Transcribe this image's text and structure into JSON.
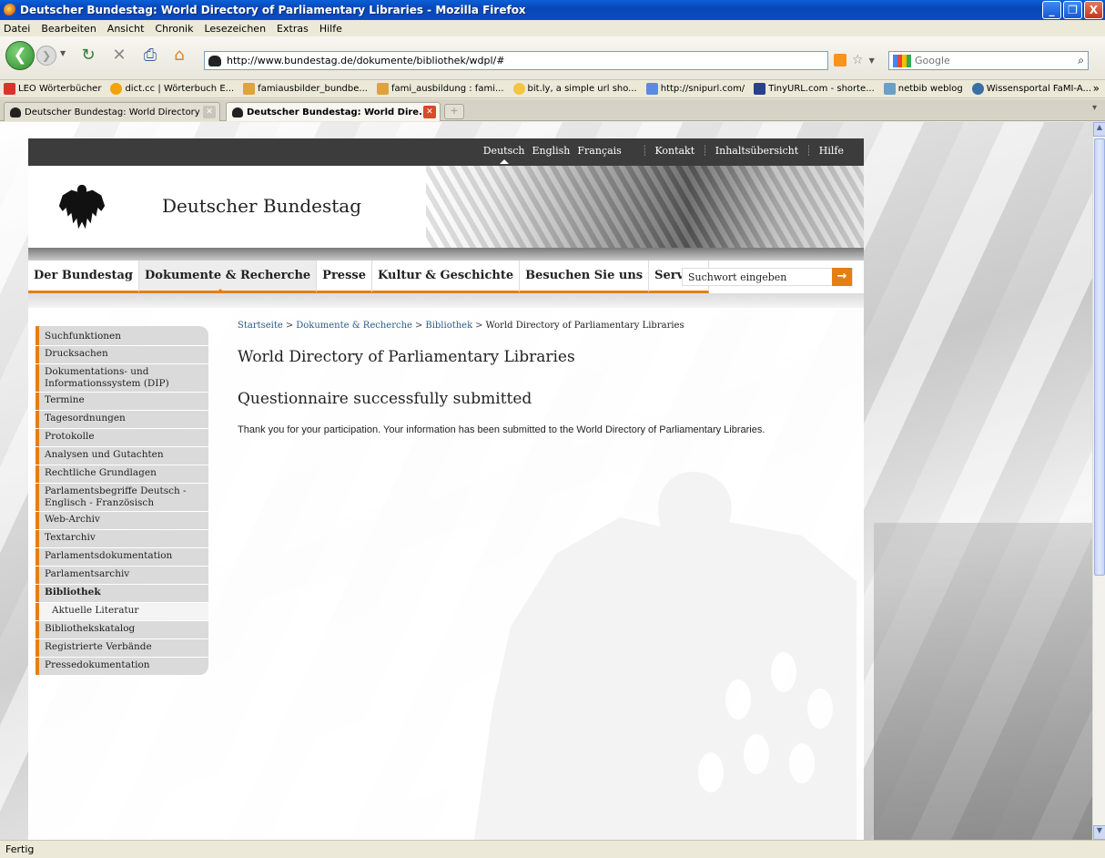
{
  "window": {
    "title": "Deutscher Bundestag: World Directory of Parliamentary Libraries - Mozilla Firefox",
    "buttons": {
      "minimize": "_",
      "maximize": "❐",
      "close": "X"
    }
  },
  "menu": [
    "Datei",
    "Bearbeiten",
    "Ansicht",
    "Chronik",
    "Lesezeichen",
    "Extras",
    "Hilfe"
  ],
  "toolbar": {
    "url": "http://www.bundestag.de/dokumente/bibliothek/wdpl/#",
    "search_placeholder": "Google"
  },
  "bookmarks": [
    {
      "label": "LEO Wörterbücher",
      "color": "#d9342b"
    },
    {
      "label": "dict.cc | Wörterbuch E...",
      "color": "#f2a20c"
    },
    {
      "label": "famiausbilder_bundbe...",
      "color": "#e0a23c"
    },
    {
      "label": "fami_ausbildung : fami...",
      "color": "#e0a23c"
    },
    {
      "label": "bit.ly, a simple url sho...",
      "color": "#f4c542"
    },
    {
      "label": "http://snipurl.com/",
      "color": "#5a8be0"
    },
    {
      "label": "TinyURL.com - shorte...",
      "color": "#2a3f8f"
    },
    {
      "label": "netbib weblog",
      "color": "#6aa0c8"
    },
    {
      "label": "Wissensportal FaMI-A...",
      "color": "#3a6ea5"
    }
  ],
  "tabs": [
    {
      "label": "Deutscher Bundestag: World Directory ...",
      "active": false
    },
    {
      "label": "Deutscher Bundestag: World Dire...",
      "active": true
    }
  ],
  "site": {
    "languages": [
      "Deutsch",
      "English",
      "Français"
    ],
    "utility_links": [
      "Kontakt",
      "Inhaltsübersicht",
      "Hilfe"
    ],
    "title": "Deutscher Bundestag",
    "nav": [
      "Der Bundestag",
      "Dokumente & Recherche",
      "Presse",
      "Kultur & Geschichte",
      "Besuchen Sie uns",
      "Service"
    ],
    "search_placeholder": "Suchwort eingeben",
    "search_go": "→"
  },
  "sidebar": [
    {
      "label": "Suchfunktionen"
    },
    {
      "label": "Drucksachen"
    },
    {
      "label": "Dokumentations- und Informationssystem (DIP)"
    },
    {
      "label": "Termine"
    },
    {
      "label": "Tagesordnungen"
    },
    {
      "label": "Protokolle"
    },
    {
      "label": "Analysen und Gutachten"
    },
    {
      "label": "Rechtliche Grundlagen"
    },
    {
      "label": "Parlamentsbegriffe Deutsch - Englisch - Französisch"
    },
    {
      "label": "Web-Archiv"
    },
    {
      "label": "Textarchiv"
    },
    {
      "label": "Parlamentsdokumentation"
    },
    {
      "label": "Parlamentsarchiv"
    },
    {
      "label": "Bibliothek",
      "bold": true
    },
    {
      "label": "Aktuelle Literatur",
      "sub": true
    },
    {
      "label": "Bibliothekskatalog"
    },
    {
      "label": "Registrierte Verbände"
    },
    {
      "label": "Pressedokumentation"
    }
  ],
  "breadcrumb": {
    "links": [
      "Startseite",
      "Dokumente & Recherche",
      "Bibliothek"
    ],
    "current": "World Directory of Parliamentary Libraries",
    "separator": ">"
  },
  "main": {
    "title": "World Directory of Parliamentary Libraries",
    "subtitle": "Questionnaire successfully submitted",
    "message": "Thank you for your participation. Your information has been submitted to the World Directory of Parliamentary Libraries."
  },
  "status": "Fertig",
  "colors": {
    "accent": "#e57e14",
    "link": "#2a5a88",
    "header": "#3c3c3c"
  }
}
